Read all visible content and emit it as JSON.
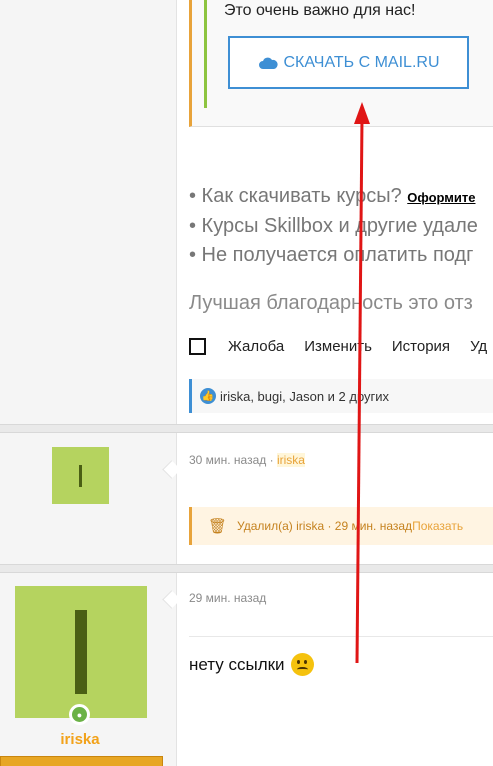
{
  "quote": {
    "text": "Это очень важно для нас!",
    "download_label": "СКАЧАТЬ С MAIL.RU",
    "cloud_icon": "cloud-icon"
  },
  "bullets": [
    {
      "text": "• Как скачивать курсы?",
      "link": "Оформите"
    },
    {
      "text": "• Курсы Skillbox и другие удале"
    },
    {
      "text": "• Не получается оплатить подг"
    }
  ],
  "thanks": "Лучшая благодарность это отз",
  "actions": {
    "report": "Жалоба",
    "edit": "Изменить",
    "history": "История",
    "more": "Уд"
  },
  "reactions": {
    "text": "iriska, bugi, Jason и 2 других"
  },
  "post1": {
    "time": "30 мин. назад · ",
    "user": "iriska",
    "deleted_text": "Удалил(а) iriska · 29 мин. назад ",
    "show_label": "Показать"
  },
  "post2": {
    "time": "29 мин. назад",
    "username": "iriska",
    "message": "нету ссылки"
  },
  "colors": {
    "accent_blue": "#3e8fd4",
    "accent_orange": "#e8a33a",
    "avatar_green": "#b5d35f",
    "arrow_red": "#e01515"
  }
}
